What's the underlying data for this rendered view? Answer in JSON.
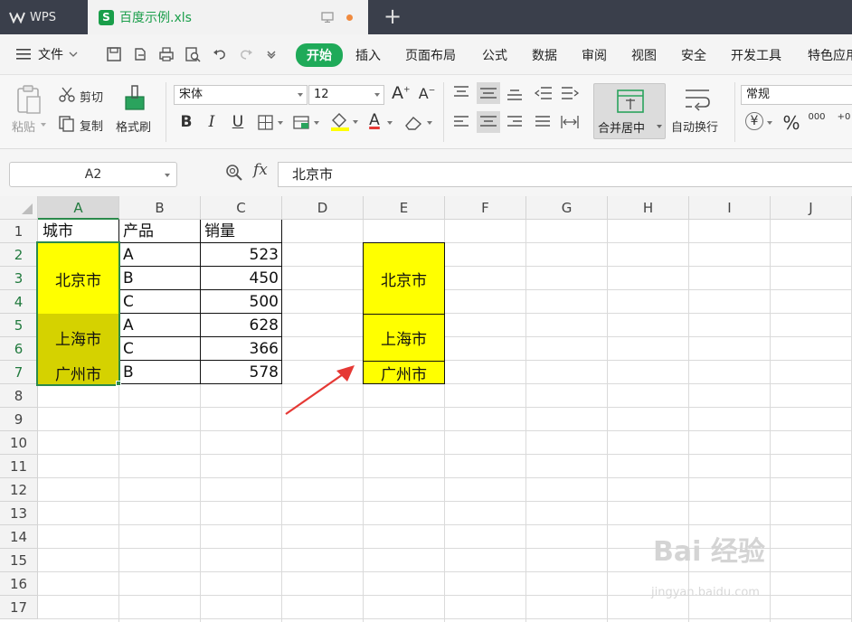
{
  "titlebar": {
    "app_name": "WPS",
    "doc_tab": "百度示例.xls",
    "doc_icon_letter": "S"
  },
  "menu": {
    "file": "文件",
    "tabs": [
      "开始",
      "插入",
      "页面布局",
      "公式",
      "数据",
      "审阅",
      "视图",
      "安全",
      "开发工具",
      "特色应用"
    ],
    "active_tab": "开始"
  },
  "ribbon": {
    "paste": "粘贴",
    "cut": "剪切",
    "copy": "复制",
    "format_painter": "格式刷",
    "font_name": "宋体",
    "font_size": "12",
    "bold": "B",
    "italic": "I",
    "underline": "U",
    "font_color_glyph": "A",
    "merge_center": "合并居中",
    "wrap_text": "自动换行",
    "number_format": "常规",
    "currency_glyph": "¥",
    "percent_glyph": "%",
    "thousands_glyph": "000",
    "grow_font_glyph": "A",
    "shrink_font_glyph": "A",
    "accent_color": "#1faa59"
  },
  "formula_bar": {
    "name_box": "A2",
    "fx": "fx",
    "value": "北京市"
  },
  "sheet": {
    "columns": [
      "A",
      "B",
      "C",
      "D",
      "E",
      "F",
      "G",
      "H",
      "I",
      "J"
    ],
    "rows": [
      "1",
      "2",
      "3",
      "4",
      "5",
      "6",
      "7",
      "8",
      "9",
      "10",
      "11",
      "12",
      "13",
      "14",
      "15",
      "16",
      "17"
    ],
    "headers": {
      "a1": "城市",
      "b1": "产品",
      "c1": "销量"
    },
    "table_rows": [
      {
        "product": "A",
        "sales": "523"
      },
      {
        "product": "B",
        "sales": "450"
      },
      {
        "product": "C",
        "sales": "500"
      },
      {
        "product": "A",
        "sales": "628"
      },
      {
        "product": "C",
        "sales": "366"
      },
      {
        "product": "B",
        "sales": "578"
      }
    ],
    "merged_cities": [
      "北京市",
      "上海市",
      "广州市"
    ],
    "result_cities": [
      "北京市",
      "上海市",
      "广州市"
    ],
    "fill_colors": {
      "yellow": "#ffff00",
      "selected_fill": "#d5d200",
      "selection_border": "#2b8a4b",
      "arrow": "#e53935"
    }
  },
  "watermark": {
    "brand": "Bai 经验",
    "url": "jingyan.baidu.com"
  }
}
